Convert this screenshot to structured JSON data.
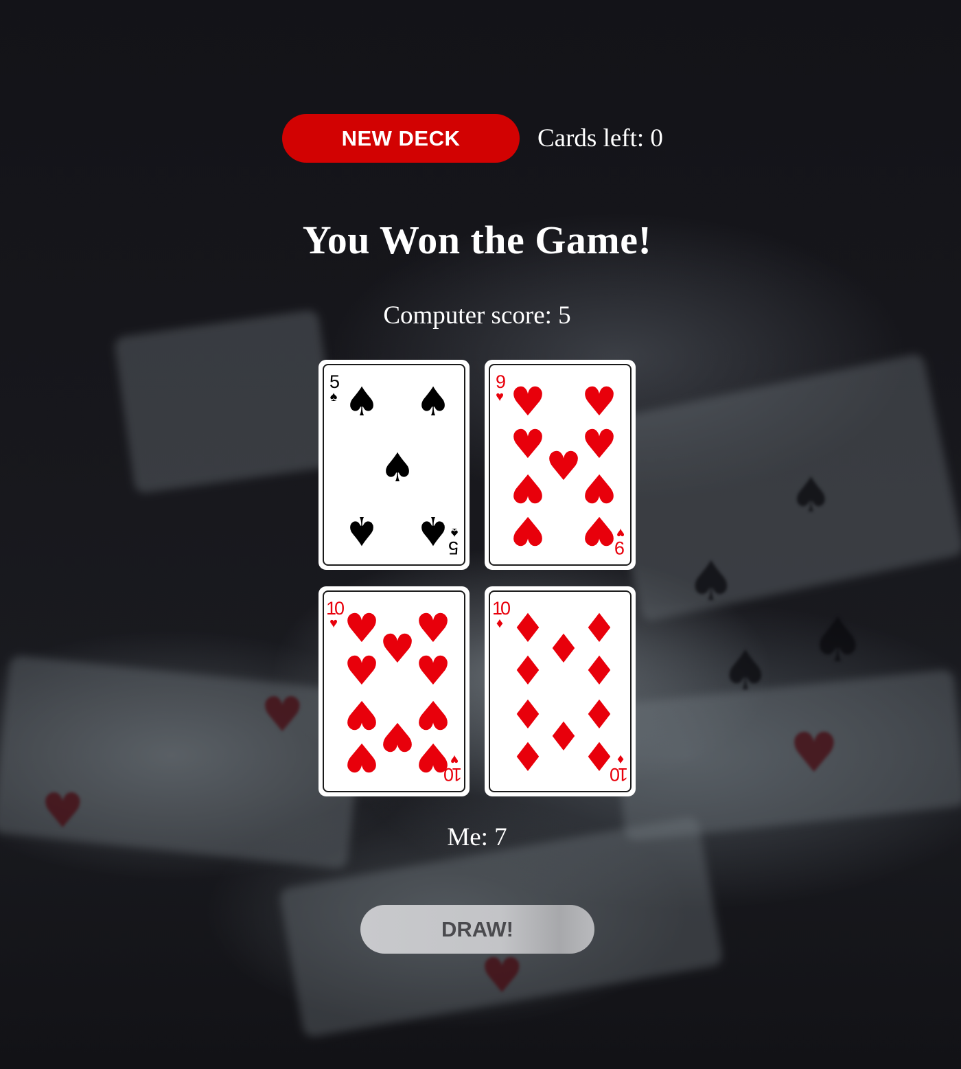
{
  "toolbar": {
    "new_deck_label": "NEW DECK",
    "cards_left_text": "Cards left: 0"
  },
  "status": {
    "headline": "You Won the Game!"
  },
  "computer": {
    "score_text": "Computer score: 5",
    "score": 5
  },
  "me": {
    "score_text": "Me: 7",
    "score": 7
  },
  "draw_button_label": "DRAW!",
  "cards": [
    {
      "rank": "5",
      "suit": "♠",
      "suit_name": "spades",
      "color": "#000000"
    },
    {
      "rank": "9",
      "suit": "♥",
      "suit_name": "hearts",
      "color": "#e8000b"
    },
    {
      "rank": "10",
      "suit": "♥",
      "suit_name": "hearts",
      "color": "#e8000b"
    },
    {
      "rank": "10",
      "suit": "♦",
      "suit_name": "diamonds",
      "color": "#e8000b"
    }
  ],
  "colors": {
    "new_deck_button": "#d20202",
    "draw_button": "#c3c4c7",
    "background": "#16161b"
  }
}
